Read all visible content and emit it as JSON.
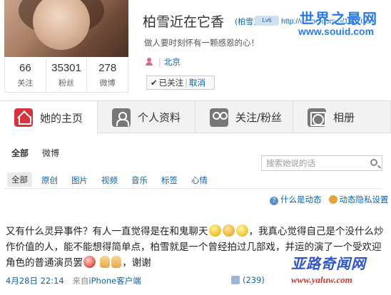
{
  "profile": {
    "name": "柏雪近在它香",
    "alias": "(柏雪)",
    "badge": "Lv6",
    "url": "http://weibo.com/u/1852024",
    "bio": "做人要时刻怀有一颗感恩的心！",
    "location": "北京",
    "followed_label": "已关注",
    "cancel_label": "取消",
    "stats": [
      {
        "value": "66",
        "label": "关注"
      },
      {
        "value": "35301",
        "label": "粉丝"
      },
      {
        "value": "278",
        "label": "微博"
      }
    ]
  },
  "watermark_top": {
    "line1": "世界之最网",
    "line2": "www.souid.com"
  },
  "tabs": [
    {
      "label": "她的主页",
      "icon": "home-icon"
    },
    {
      "label": "个人资料",
      "icon": "person-icon"
    },
    {
      "label": "关注/粉丝",
      "icon": "people-icon"
    },
    {
      "label": "相册",
      "icon": "camera-icon"
    }
  ],
  "subnav": {
    "all": "全部",
    "weibo": "微博"
  },
  "search": {
    "placeholder": "搜索她说的话"
  },
  "filters": [
    "全部",
    "原创",
    "图片",
    "视频",
    "音乐",
    "标签",
    "心情"
  ],
  "dynamics": {
    "what": "什么是动态",
    "privacy": "动态隐私设置"
  },
  "post": {
    "text_part1": "又有什么灵异事件？有人一直觉得是在和鬼聊天",
    "text_part2": "，我真心觉得自己是个没什么炒作价值的人，能不能想得简单点，柏雪就是一个曾经拍过几部戏，并",
    "text_part3": "运的演了一个受欢迎角色的普通演员罢",
    "text_part4": "，谢谢",
    "date": "4月28日 22:14",
    "client_prefix": "来自",
    "client": "iPhone客户端",
    "likes": "(239)"
  },
  "watermark_bottom": {
    "line1": "亚路奇闻网",
    "line2": "www.yaluw.com"
  }
}
